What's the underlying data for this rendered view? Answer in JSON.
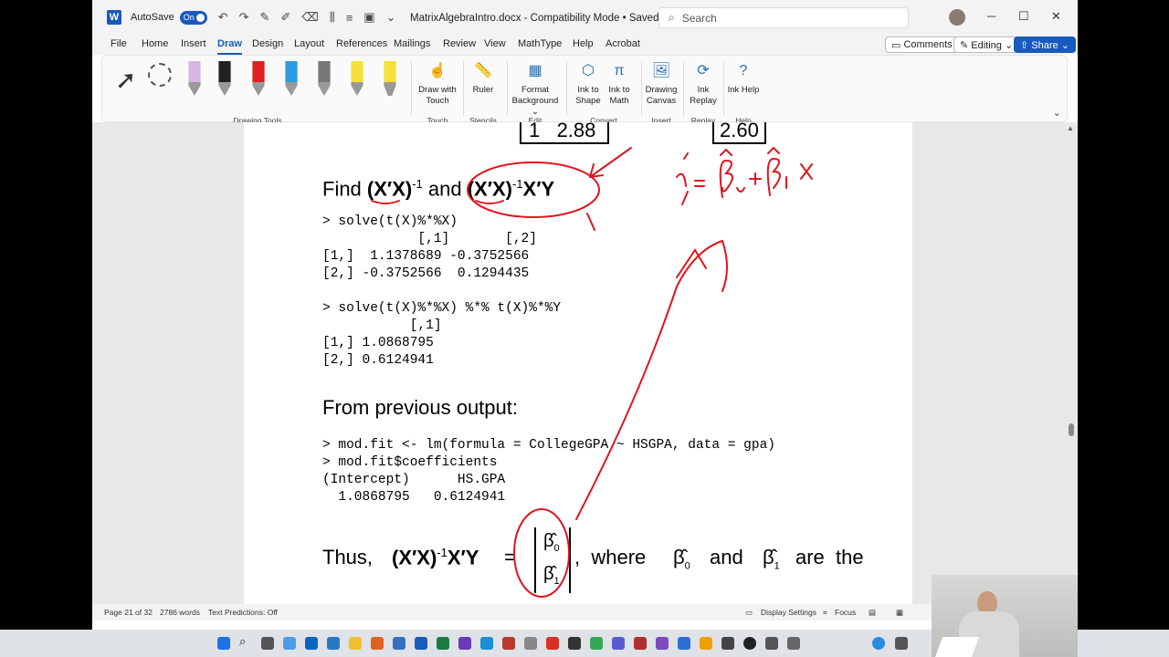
{
  "titlebar": {
    "autosave_label": "AutoSave",
    "autosave_state": "On",
    "doc_title": "MatrixAlgebraIntro.docx  -  Compatibility Mode  •  Saved ⌄",
    "search_placeholder": "Search",
    "minimize": "─",
    "maximize": "☐",
    "close": "✕"
  },
  "menubar": {
    "items": [
      "File",
      "Home",
      "Insert",
      "Draw",
      "Design",
      "Layout",
      "References",
      "Mailings",
      "Review",
      "View",
      "MathType",
      "Help",
      "Acrobat"
    ],
    "comments": "Comments",
    "editing": "Editing ⌄",
    "share": "Share ⌄"
  },
  "ribbon": {
    "group_drawing_tools": "Drawing Tools",
    "draw_with_touch": "Draw with Touch",
    "group_touch": "Touch",
    "ruler": "Ruler",
    "group_stencils": "Stencils",
    "format_background": "Format Background ⌄",
    "group_edit": "Edit",
    "ink_to_shape": "Ink to Shape",
    "ink_to_math": "Ink to Math",
    "group_convert": "Convert",
    "drawing_canvas": "Drawing Canvas",
    "group_insert": "Insert",
    "ink_replay": "Ink Replay",
    "group_replay": "Replay",
    "ink_help": "Ink Help",
    "group_help": "Help",
    "pen_colors": [
      "#d8b4e2",
      "#222222",
      "#e02020",
      "#2a9de0",
      "#777777",
      "#f5e13a"
    ]
  },
  "document": {
    "matrix_row_a": "1   2.88",
    "matrix_row_b": "2.60",
    "find_prefix": "Find ",
    "find_xx1": "(X′X)",
    "find_sup": "-1",
    "find_and": " and ",
    "find_xx2": "(X′X)",
    "find_sup2": "-1",
    "find_xy": "X′Y",
    "code1": "> solve(t(X)%*%X)\n            [,1]       [,2]\n[1,]  1.1378689 -0.3752566\n[2,] -0.3752566  0.1294435",
    "code2": "> solve(t(X)%*%X) %*% t(X)%*%Y\n           [,1]\n[1,] 1.0868795\n[2,] 0.6124941",
    "from_previous": "From previous output:",
    "code3": "> mod.fit <- lm(formula = CollegeGPA ~ HSGPA, data = gpa)\n> mod.fit$coefficients\n(Intercept)      HS.GPA\n  1.0868795   0.6124941",
    "thus": "Thus,",
    "thus_expr": "(X′X)",
    "thus_sup": "-1",
    "thus_xy": "X′Y",
    "equals": "=",
    "beta0": "β̂",
    "beta0_sub": "0",
    "beta1": "β̂",
    "beta1_sub": "1",
    "where_text": ",  where",
    "and_text": "and",
    "are_the": "are  the"
  },
  "statusbar": {
    "page": "Page 21 of 32",
    "words": "2786 words",
    "predictions": "Text Predictions: Off",
    "display_settings": "Display Settings",
    "focus": "Focus"
  }
}
